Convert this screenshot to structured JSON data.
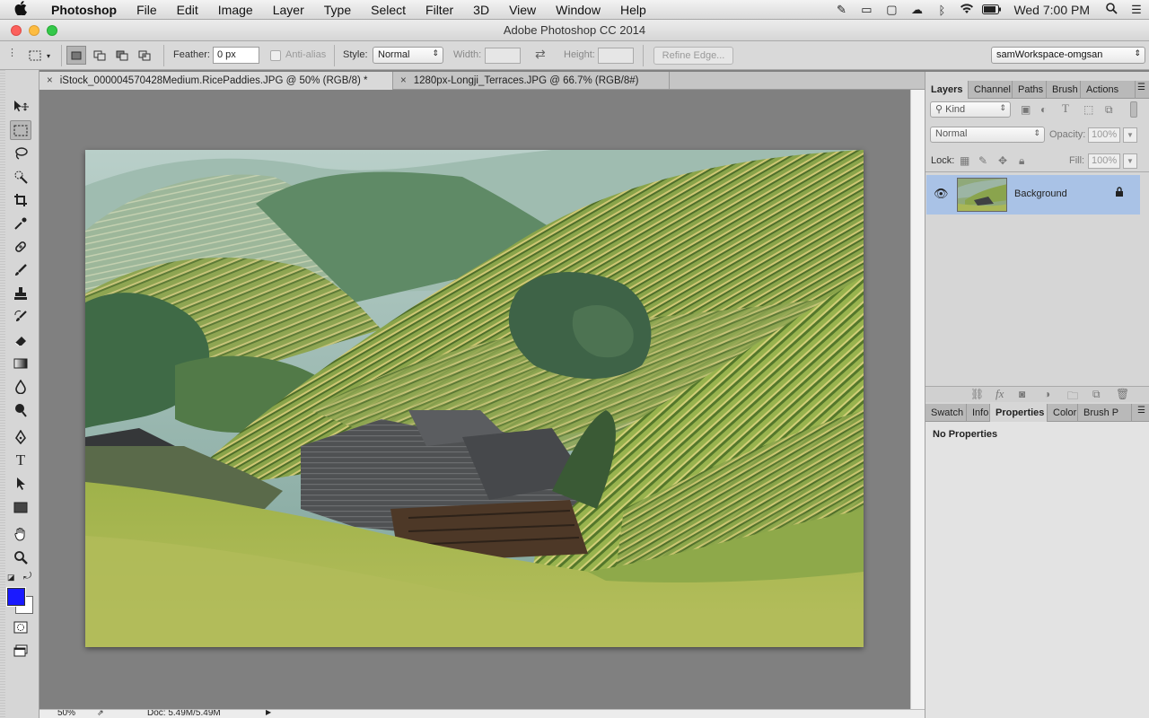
{
  "menubar": {
    "apple_glyph": "",
    "app_name": "Photoshop",
    "items": [
      "File",
      "Edit",
      "Image",
      "Layer",
      "Type",
      "Select",
      "Filter",
      "3D",
      "View",
      "Window",
      "Help"
    ],
    "clock": "Wed 7:00 PM",
    "status_icons": [
      "pen-icon",
      "airplay-icon",
      "stop-icon",
      "cloud-icon",
      "bluetooth-icon",
      "wifi-icon",
      "battery-icon",
      "search-icon",
      "list-icon"
    ]
  },
  "window": {
    "title": "Adobe Photoshop CC 2014"
  },
  "options": {
    "feather_label": "Feather:",
    "feather_value": "0 px",
    "antialias_label": "Anti-alias",
    "style_label": "Style:",
    "style_value": "Normal",
    "width_label": "Width:",
    "height_label": "Height:",
    "refine_edge": "Refine Edge...",
    "workspace": "samWorkspace-omgsan"
  },
  "doc_tabs": [
    {
      "title": "iStock_000004570428Medium.RicePaddies.JPG @ 50% (RGB/8) *",
      "close": "×",
      "active": true
    },
    {
      "title": "1280px-Longji_Terraces.JPG @ 66.7% (RGB/8#)",
      "close": "×",
      "active": false
    }
  ],
  "statusbar": {
    "zoom": "50%",
    "doc": "Doc: 5.49M/5.49M"
  },
  "layers_panel": {
    "tabs": [
      "Layers",
      "Channel",
      "Paths",
      "Brush",
      "Actions"
    ],
    "filter_kind": "Kind",
    "blend_mode": "Normal",
    "opacity_label": "Opacity:",
    "opacity_value": "100%",
    "lock_label": "Lock:",
    "fill_label": "Fill:",
    "fill_value": "100%",
    "layer_name": "Background",
    "fx_glyph": "fx"
  },
  "properties_panel": {
    "tabs": [
      "Swatch",
      "Info",
      "Properties",
      "Color",
      "Brush P"
    ],
    "message": "No Properties"
  },
  "colors": {
    "foreground": "#1a1aff",
    "background": "#ffffff",
    "selected_layer": "#a9c2e6"
  }
}
